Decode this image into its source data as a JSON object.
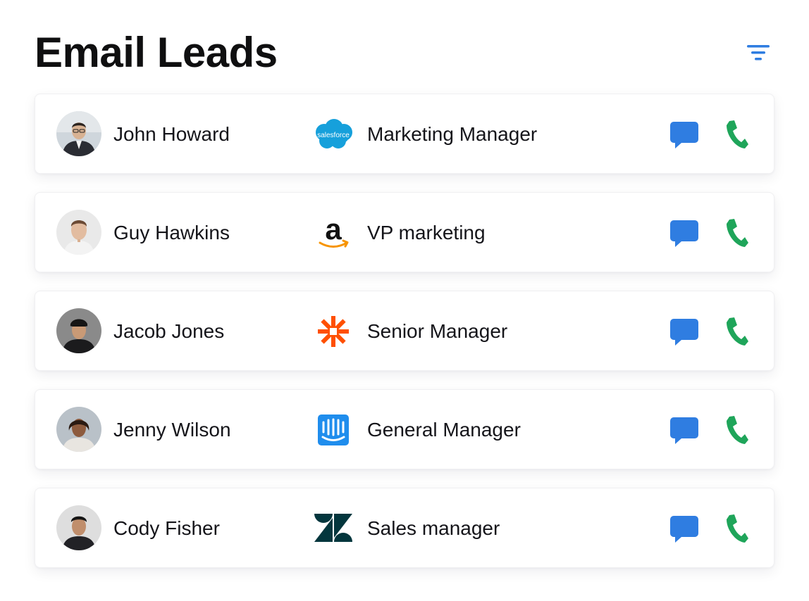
{
  "header": {
    "title": "Email Leads",
    "filter_icon": "filter-icon",
    "accent_color": "#2f7de1"
  },
  "leads": [
    {
      "name": "John Howard",
      "company_icon": "salesforce-logo",
      "company_logo_text": "salesforce",
      "role": "Marketing Manager",
      "message_icon": "message-icon",
      "call_icon": "phone-icon"
    },
    {
      "name": "Guy Hawkins",
      "company_icon": "amazon-logo",
      "company_logo_text": "a",
      "role": "VP marketing",
      "message_icon": "message-icon",
      "call_icon": "phone-icon"
    },
    {
      "name": "Jacob Jones",
      "company_icon": "zapier-logo",
      "role": "Senior Manager",
      "message_icon": "message-icon",
      "call_icon": "phone-icon"
    },
    {
      "name": "Jenny Wilson",
      "company_icon": "intercom-logo",
      "role": "General Manager",
      "message_icon": "message-icon",
      "call_icon": "phone-icon"
    },
    {
      "name": "Cody Fisher",
      "company_icon": "zendesk-logo",
      "role": "Sales manager",
      "message_icon": "message-icon",
      "call_icon": "phone-icon"
    }
  ],
  "colors": {
    "message": "#2f7de1",
    "call": "#1fa55a",
    "salesforce": "#16a0db",
    "amazon_arrow": "#f79400",
    "zapier": "#ff4f00",
    "intercom": "#1f8ded",
    "zendesk": "#03363d"
  }
}
